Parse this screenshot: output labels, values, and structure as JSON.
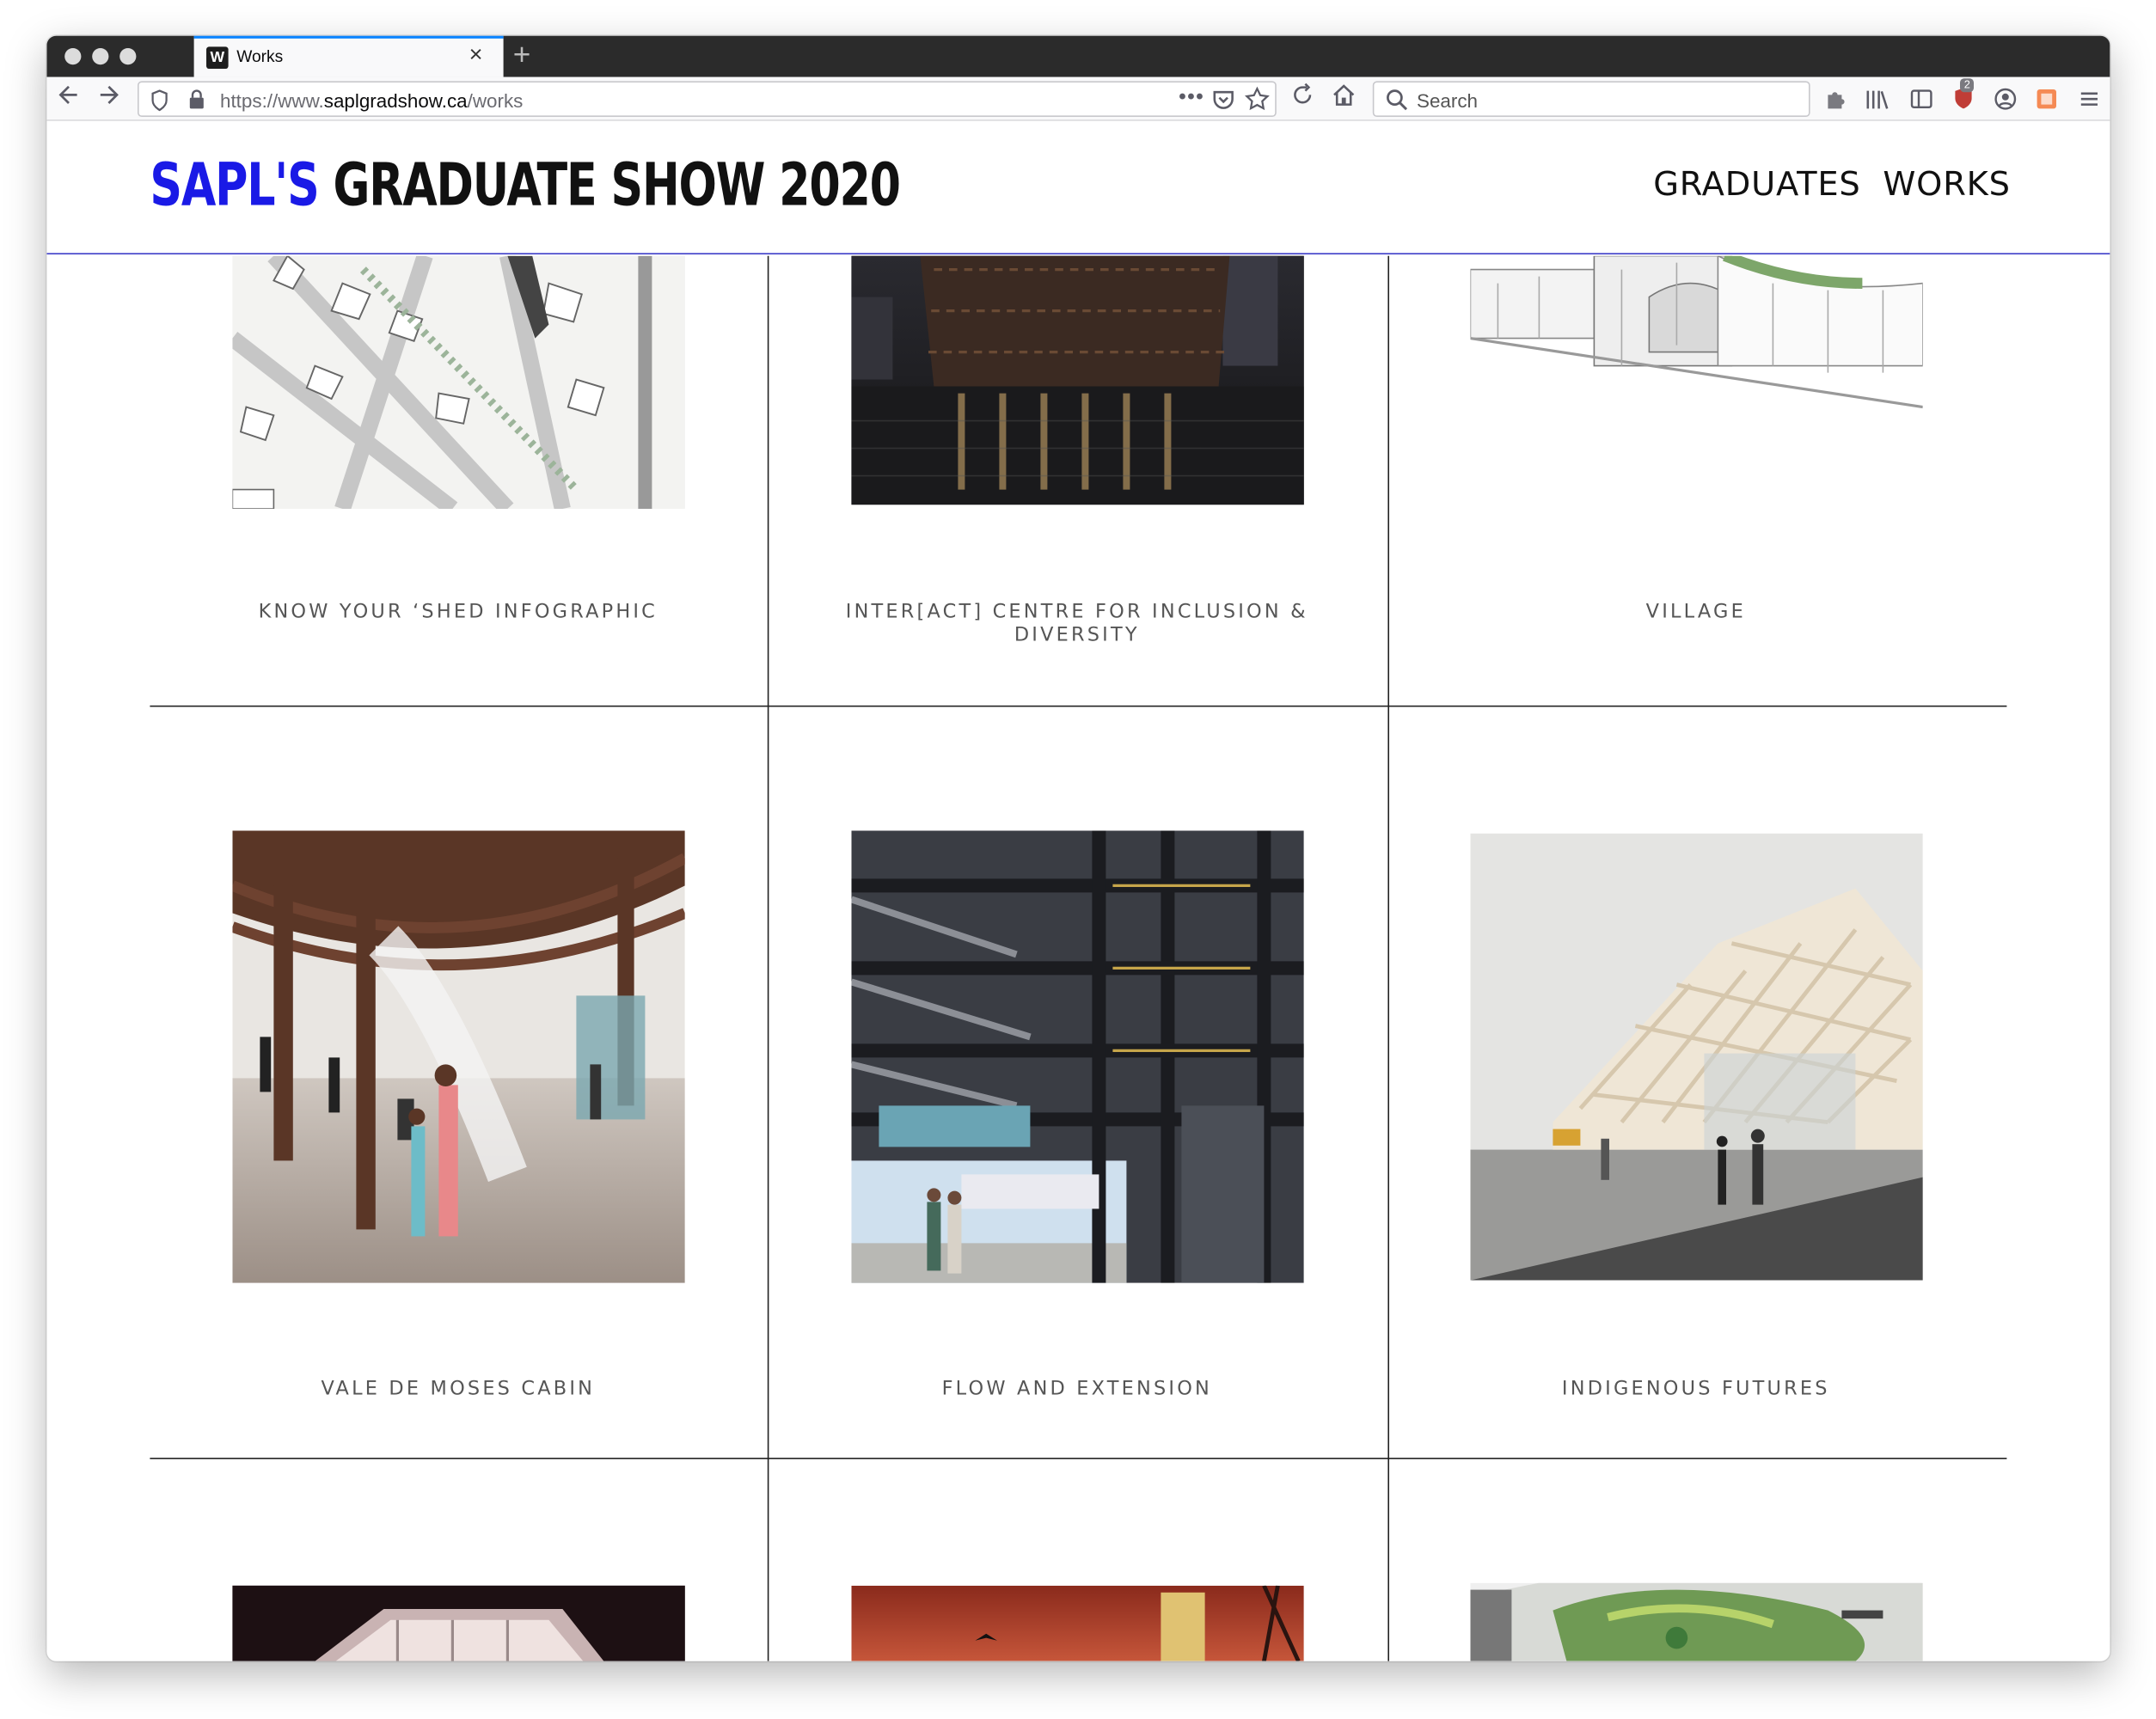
{
  "browser": {
    "tab_title": "Works",
    "favicon_letter": "W",
    "url_prefix": "https://www.",
    "url_domain": "saplgradshow.ca",
    "url_path": "/works",
    "search_placeholder": "Search",
    "notification_badge": "2"
  },
  "site": {
    "brand": "SAPL'S",
    "title": "GRADUATE SHOW 2020",
    "nav": [
      "GRADUATES",
      "WORKS"
    ]
  },
  "works": [
    {
      "title": "KNOW YOUR ‘SHED INFOGRAPHIC",
      "image": "site-plan-map"
    },
    {
      "title": "INTER[ACT] CENTRE FOR INCLUSION & DIVERSITY",
      "image": "night-waterfront-render"
    },
    {
      "title": "VILLAGE",
      "image": "section-drawing"
    },
    {
      "title": "VALE DE MOSES CABIN",
      "image": "pavilion-interior-render"
    },
    {
      "title": "FLOW AND EXTENSION",
      "image": "steel-frame-structure-render"
    },
    {
      "title": "INDIGENOUS FUTURES",
      "image": "lattice-building-render"
    },
    {
      "title": "",
      "image": "glowing-pavilion-night-render"
    },
    {
      "title": "",
      "image": "tower-sunset-render"
    },
    {
      "title": "",
      "image": "green-roof-plan"
    }
  ]
}
